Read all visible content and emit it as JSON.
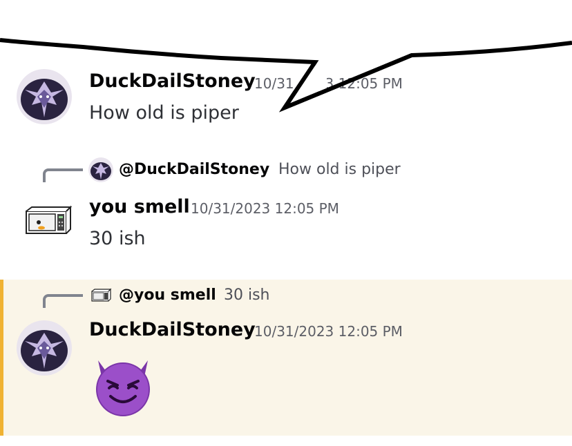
{
  "messages": [
    {
      "username": "DuckDailStoney",
      "timestamp": "10/31/2023 12:05 PM",
      "content": "How old is piper"
    },
    {
      "reply": {
        "username": "@DuckDailStoney",
        "text": "How old is piper"
      },
      "username": "you smell",
      "timestamp": "10/31/2023 12:05 PM",
      "content": "30 ish"
    },
    {
      "reply": {
        "username": "@you smell",
        "text": "30 ish"
      },
      "username": "DuckDailStoney",
      "timestamp": "10/31/2023 12:05 PM",
      "content_emoji": "smiling-face-with-horns",
      "highlighted": true
    }
  ],
  "colors": {
    "highlight_bg": "#faf5e8",
    "highlight_bar": "#f0b232",
    "emoji_purple": "#9b4fc9"
  }
}
